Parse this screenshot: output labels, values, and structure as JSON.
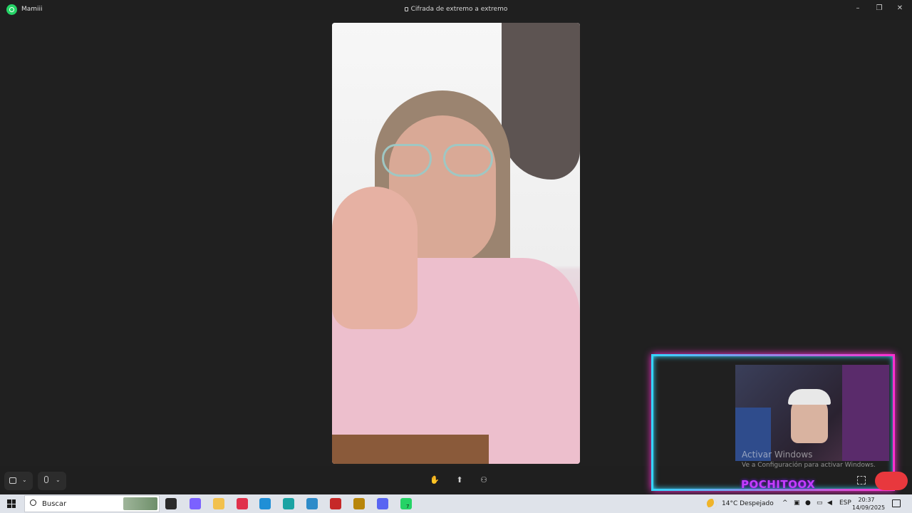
{
  "window": {
    "contact_name": "Mamiii",
    "encryption_label": "Cifrada de extremo a extremo",
    "minimize_glyph": "–",
    "restore_glyph": "❐",
    "close_glyph": "✕"
  },
  "controls": {
    "camera_chevron": "⌄",
    "mic_chevron": "⌄",
    "raise_hand_glyph": "✋",
    "share_screen_glyph": "⬆",
    "add_participant_glyph": "⚇"
  },
  "overlay": {
    "watermark_title": "Activar Windows",
    "watermark_subtitle": "Ve a Configuración para activar Windows.",
    "streamer_name": "POCHITOOX"
  },
  "taskbar": {
    "search_placeholder": "Buscar",
    "weather_text": "14°C  Despejado",
    "language": "ESP",
    "time": "20:37",
    "date": "14/09/2025",
    "badge_count": "7",
    "tray_chevron": "^",
    "apps": [
      {
        "name": "task-view-icon",
        "color": "#2b2b2b"
      },
      {
        "name": "copilot-icon",
        "color": "#7b61ff"
      },
      {
        "name": "file-explorer-icon",
        "color": "#f2c14e"
      },
      {
        "name": "opera-icon",
        "color": "#e0314b"
      },
      {
        "name": "edge-icon",
        "color": "#1f8fd6"
      },
      {
        "name": "edge-dev-icon",
        "color": "#1aa3a3"
      },
      {
        "name": "edge-beta-icon",
        "color": "#2d8bc9"
      },
      {
        "name": "app-red-icon",
        "color": "#c62828"
      },
      {
        "name": "league-icon",
        "color": "#b8860b"
      },
      {
        "name": "discord-icon",
        "color": "#5865f2"
      },
      {
        "name": "whatsapp-icon",
        "color": "#25d366"
      }
    ]
  },
  "colors": {
    "whatsapp_green": "#25d366",
    "end_call_red": "#e8383d",
    "overlay_cyan": "#35d6ff",
    "overlay_magenta": "#ff2fd0"
  }
}
